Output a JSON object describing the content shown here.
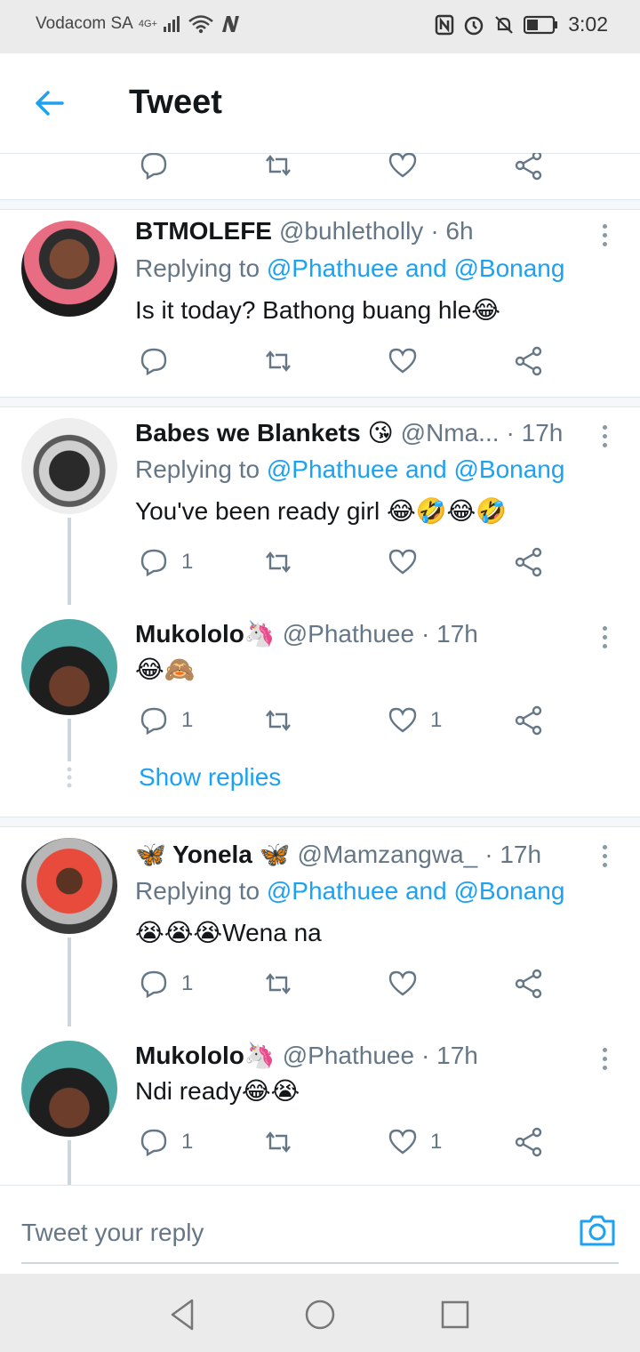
{
  "status_bar": {
    "carrier": "Vodacom SA",
    "network": "4G+",
    "time": "3:02"
  },
  "header": {
    "title": "Tweet"
  },
  "tweets": [
    {
      "name": "BTMOLEFE",
      "handle": "@buhletholly",
      "time": "· 6h",
      "replying_prefix": "Replying to",
      "replying_users": "@Phathuee and @Bonang",
      "text": "Is it today? Bathong buang hle😂",
      "reply_count": "",
      "like_count": ""
    },
    {
      "name": "Babes we Blankets 😘",
      "handle": "@Nma...",
      "time": "· 17h",
      "replying_prefix": "Replying to",
      "replying_users": "@Phathuee and @Bonang",
      "text": "You've been ready girl 😂🤣😂🤣",
      "reply_count": "1",
      "like_count": ""
    },
    {
      "name": "Mukololo🦄",
      "handle": "@Phathuee",
      "time": "· 17h",
      "text": "😂🙈",
      "reply_count": "1",
      "like_count": "1"
    },
    {
      "name": "🦋 Yonela 🦋",
      "handle": "@Mamzangwa_",
      "time": "· 17h",
      "replying_prefix": "Replying to",
      "replying_users": "@Phathuee and @Bonang",
      "text": "😭😭😭Wena na",
      "reply_count": "1",
      "like_count": ""
    },
    {
      "name": "Mukololo🦄",
      "handle": "@Phathuee",
      "time": "· 17h",
      "text": "Ndi ready😂😭",
      "reply_count": "1",
      "like_count": "1"
    }
  ],
  "show_replies_label": "Show replies",
  "reply_bar": {
    "placeholder": "Tweet your reply"
  },
  "colors": {
    "accent": "#1da1f2",
    "secondary_text": "#657786",
    "divider": "#e1e8ed"
  }
}
